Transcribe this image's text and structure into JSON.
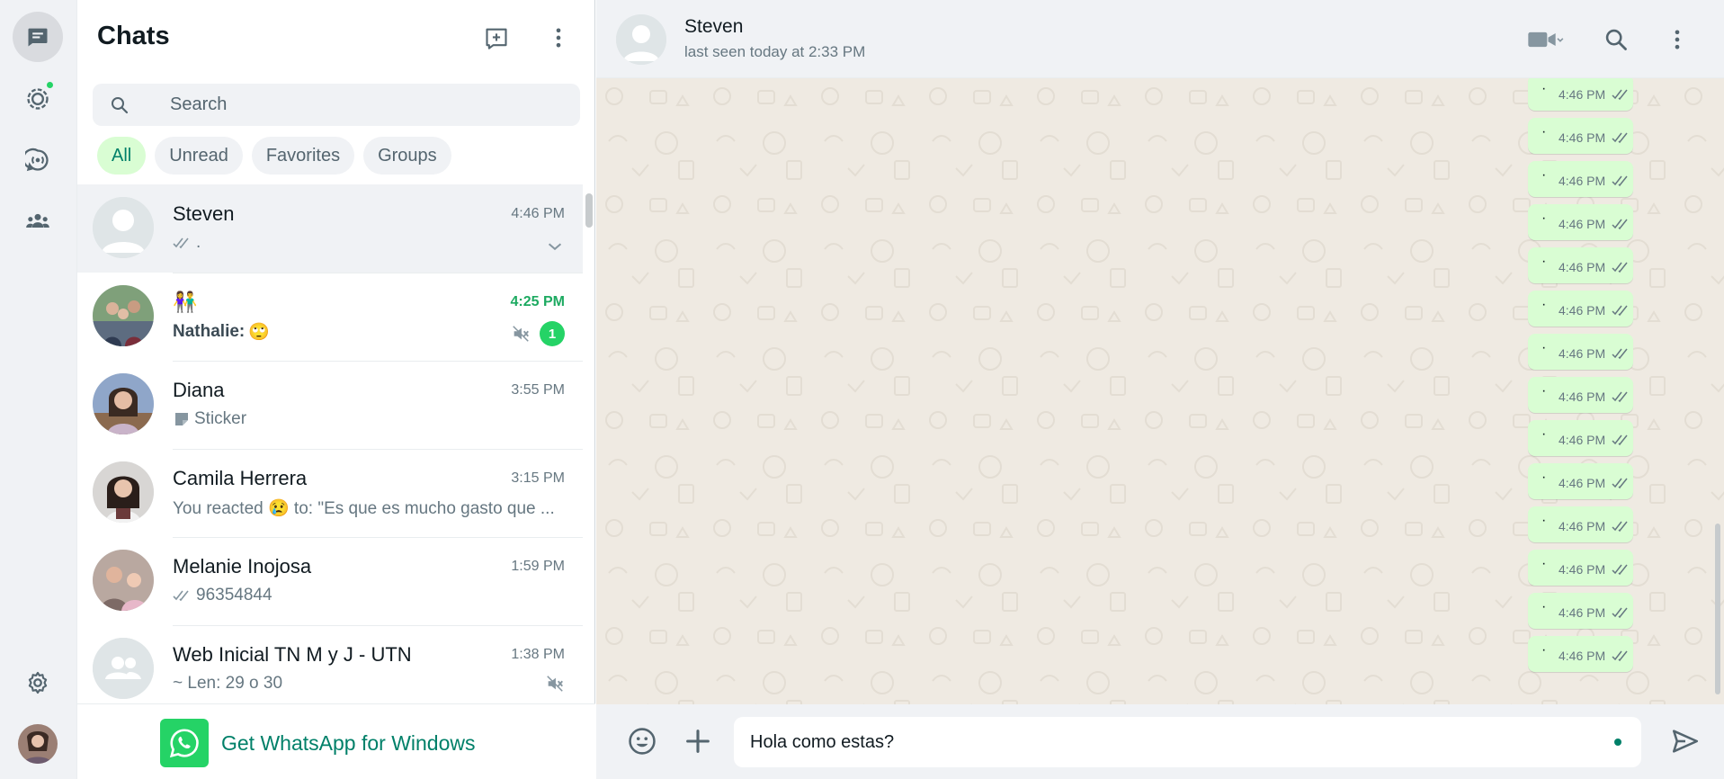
{
  "rail": {
    "items": [
      {
        "name": "chats-icon",
        "active": true
      },
      {
        "name": "status-icon",
        "has_dot": true
      },
      {
        "name": "channels-icon"
      },
      {
        "name": "communities-icon"
      }
    ],
    "settings_icon": "gear-icon",
    "profile_avatar": "profile-photo"
  },
  "list": {
    "title": "Chats",
    "new_chat_icon": "new-chat-icon",
    "menu_icon": "menu-icon",
    "search_placeholder": "Search",
    "filters": [
      {
        "label": "All",
        "active": true
      },
      {
        "label": "Unread"
      },
      {
        "label": "Favorites"
      },
      {
        "label": "Groups"
      }
    ],
    "chats": [
      {
        "name": "Steven",
        "time": "4:46 PM",
        "preview": ".",
        "ticks": true,
        "selected": true,
        "dropdown": true
      },
      {
        "name": "👫",
        "time": "4:25 PM",
        "sender": "Nathalie:",
        "preview": "🙄",
        "muted": true,
        "unread_count": "1",
        "unread": true
      },
      {
        "name": "Diana",
        "time": "3:55 PM",
        "preview": "Sticker",
        "sticker": true
      },
      {
        "name": "Camila Herrera",
        "time": "3:15 PM",
        "preview": "You reacted 😢 to: \"Es que es mucho gasto que ..."
      },
      {
        "name": "Melanie Inojosa",
        "time": "1:59 PM",
        "preview": "96354844",
        "ticks": true
      },
      {
        "name": "Web Inicial TN M y J - UTN",
        "time": "1:38 PM",
        "preview": "~ Len: 29 o 30",
        "muted": true,
        "group": true
      }
    ],
    "promo_text": "Get WhatsApp for Windows"
  },
  "conversation": {
    "name": "Steven",
    "status": "last seen today at 2:33 PM",
    "header_icons": [
      "video-call-icon",
      "search-icon",
      "menu-icon"
    ],
    "messages": [
      {
        "text": "·",
        "time": "4:46 PM"
      },
      {
        "text": "·",
        "time": "4:46 PM"
      },
      {
        "text": "·",
        "time": "4:46 PM"
      },
      {
        "text": "·",
        "time": "4:46 PM"
      },
      {
        "text": "·",
        "time": "4:46 PM"
      },
      {
        "text": "·",
        "time": "4:46 PM"
      },
      {
        "text": "·",
        "time": "4:46 PM"
      },
      {
        "text": "·",
        "time": "4:46 PM"
      },
      {
        "text": "·",
        "time": "4:46 PM"
      },
      {
        "text": "·",
        "time": "4:46 PM"
      },
      {
        "text": "·",
        "time": "4:46 PM"
      },
      {
        "text": "·",
        "time": "4:46 PM"
      },
      {
        "text": "·",
        "time": "4:46 PM"
      },
      {
        "text": "·",
        "time": "4:46 PM"
      }
    ],
    "composer_value": "Hola como estas?",
    "colors": {
      "accent": "#25d366",
      "outgoing_bubble": "#d9fdd3",
      "wallpaper": "#efeae2",
      "brand_text": "#008069"
    }
  }
}
